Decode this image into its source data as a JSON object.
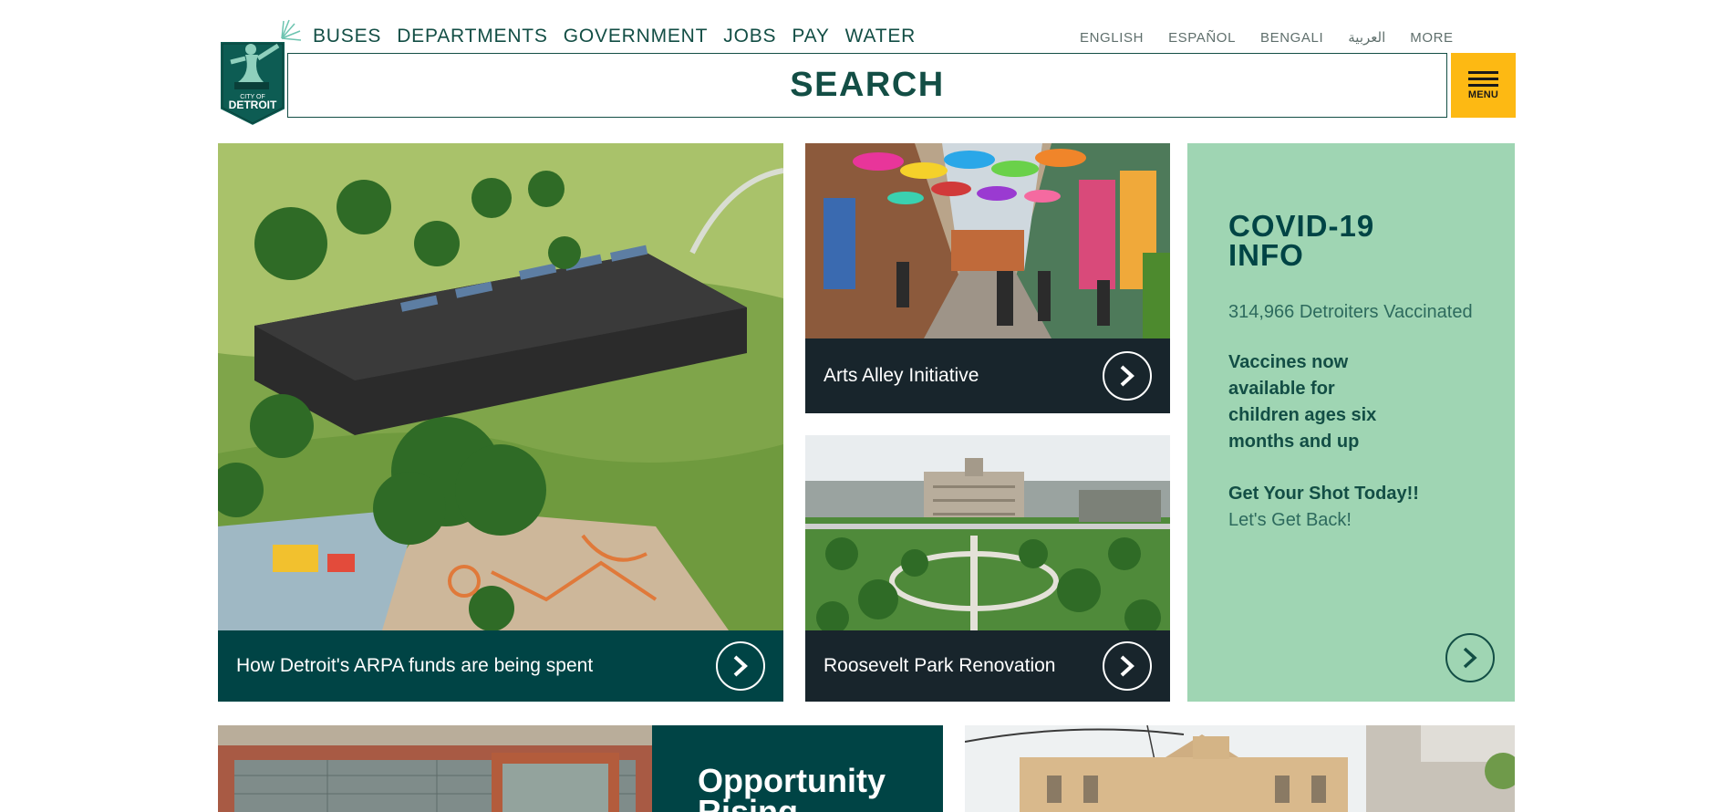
{
  "header": {
    "logo_text": "CITY OF DETROIT",
    "nav": [
      "BUSES",
      "DEPARTMENTS",
      "GOVERNMENT",
      "JOBS",
      "PAY",
      "WATER"
    ],
    "languages": [
      "ENGLISH",
      "ESPAÑOL",
      "BENGALI",
      "العربية",
      "MORE"
    ],
    "search_label": "SEARCH",
    "menu_label": "MENU"
  },
  "tiles": {
    "arpa": {
      "caption": "How Detroit's ARPA funds are being spent"
    },
    "arts": {
      "caption": "Arts Alley Initiative"
    },
    "roosevelt": {
      "caption": "Roosevelt Park Renovation"
    }
  },
  "covid": {
    "title": "COVID-19 INFO",
    "stat": "314,966 Detroiters Vaccinated",
    "vaccines": "Vaccines now available for children ages six months and up",
    "cta_bold": "Get Your Shot Today!!",
    "cta_plain": "Let's Get Back!"
  },
  "bottom": {
    "opportunity_title": "Opportunity Rising"
  },
  "colors": {
    "brand_green": "#004445",
    "mint": "#9fd5b3",
    "yellow": "#fdb913",
    "dark_caption": "#18252c"
  },
  "icons": {
    "logo": "spirit-of-detroit-logo",
    "arrow": "chevron-right-circle-icon",
    "menu": "hamburger-icon"
  }
}
